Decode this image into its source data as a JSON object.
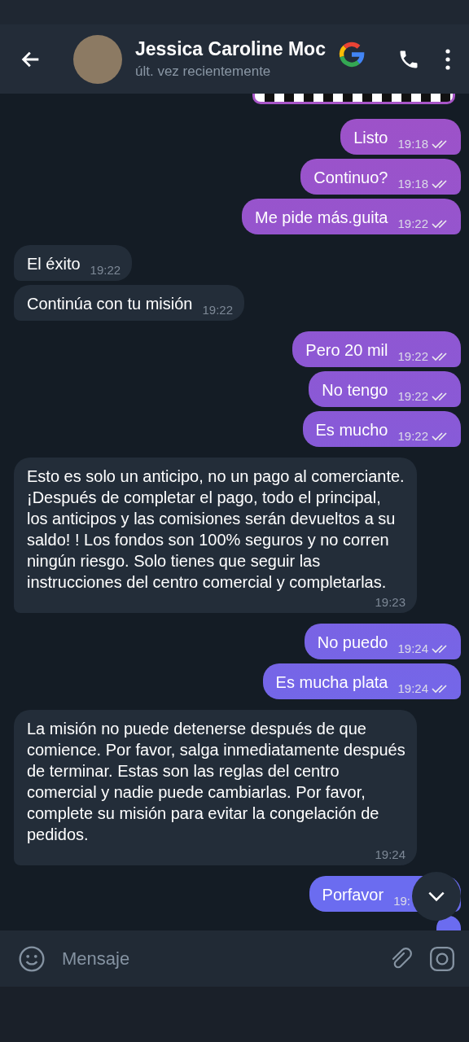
{
  "header": {
    "name": "Jessica Caroline Moc",
    "status": "últ. vez recientemente"
  },
  "messages": [
    {
      "kind": "media"
    },
    {
      "kind": "out",
      "text": "Listo",
      "time": "19:18",
      "read": true
    },
    {
      "kind": "out",
      "text": "Continuo?",
      "time": "19:18",
      "read": true
    },
    {
      "kind": "out",
      "text": "Me pide más.guita",
      "time": "19:22",
      "read": true
    },
    {
      "kind": "in",
      "text": "El éxito",
      "time": "19:22"
    },
    {
      "kind": "in",
      "text": "Continúa con tu misión",
      "time": "19:22"
    },
    {
      "kind": "out",
      "text": "Pero 20 mil",
      "time": "19:22",
      "read": true
    },
    {
      "kind": "out",
      "text": "No tengo",
      "time": "19:22",
      "read": true
    },
    {
      "kind": "out",
      "text": "Es mucho",
      "time": "19:22",
      "read": true
    },
    {
      "kind": "in",
      "text": "Esto es solo un anticipo, no un pago al comerciante. ¡Después de completar el pago, todo el principal, los anticipos y las comisiones serán devueltos a su saldo! ! Los fondos son 100% seguros y no corren ningún riesgo. Solo tienes que seguir las instrucciones del centro comercial y completarlas.",
      "time": "19:23"
    },
    {
      "kind": "out",
      "text": "No puedo",
      "time": "19:24",
      "read": true
    },
    {
      "kind": "out",
      "text": "Es mucha plata",
      "time": "19:24",
      "read": true
    },
    {
      "kind": "in",
      "text": "La misión no puede detenerse después de que comience. Por favor, salga inmediatamente después de terminar. Estas son las reglas del centro comercial y nadie puede cambiarlas. Por favor, complete su misión para evitar la congelación de pedidos.",
      "time": "19:24"
    },
    {
      "kind": "out",
      "text": "Porfavor",
      "time": "19:"
    },
    {
      "kind": "out"
    }
  ],
  "composer": {
    "placeholder": "Mensaje"
  }
}
